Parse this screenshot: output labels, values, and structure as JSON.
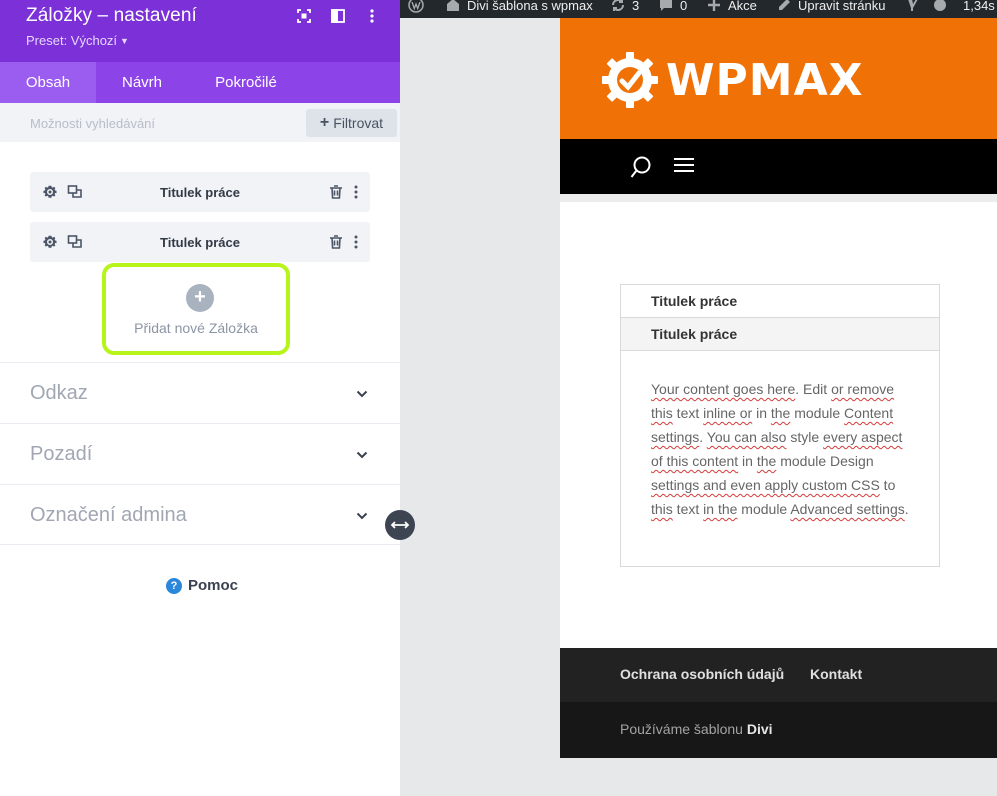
{
  "panel": {
    "title": "Záložky – nastavení",
    "preset_label": "Preset: Výchozí",
    "tabs": [
      {
        "label": "Obsah",
        "active": true
      },
      {
        "label": "Návrh",
        "active": false
      },
      {
        "label": "Pokročilé",
        "active": false
      }
    ],
    "search_placeholder": "Možnosti vyhledávání",
    "filter_label": "Filtrovat",
    "items": [
      {
        "label": "Titulek práce"
      },
      {
        "label": "Titulek práce"
      }
    ],
    "add_label": "Přidat nové Záložka",
    "sections": [
      {
        "label": "Odkaz"
      },
      {
        "label": "Pozadí"
      },
      {
        "label": "Označení admina"
      }
    ],
    "help_label": "Pomoc",
    "accent_color": "#7b30d8",
    "highlight_color": "#b7f51a"
  },
  "adminbar": {
    "site_name": "Divi šablona s wpmax",
    "updates_count": "3",
    "comments_count": "0",
    "new_label": "Akce",
    "edit_label": "Upravit stránku",
    "load_time": "1,34s"
  },
  "site": {
    "logo_text": "WPMAX",
    "brand_color": "#f07207",
    "tabs": [
      {
        "title": "Titulek práce"
      },
      {
        "title": "Titulek práce"
      }
    ],
    "content_parts": [
      {
        "t": "Your content goes here",
        "sq": true
      },
      {
        "t": ". Edit ",
        "sq": false
      },
      {
        "t": "or remove",
        "sq": true
      },
      {
        "t": " ",
        "sq": false
      },
      {
        "t": "this",
        "sq": true
      },
      {
        "t": " text ",
        "sq": false
      },
      {
        "t": "inline or",
        "sq": true
      },
      {
        "t": " in ",
        "sq": false
      },
      {
        "t": "the",
        "sq": true
      },
      {
        "t": " module ",
        "sq": false
      },
      {
        "t": "Content settings",
        "sq": true
      },
      {
        "t": ". ",
        "sq": false
      },
      {
        "t": "You can also",
        "sq": true
      },
      {
        "t": " style ",
        "sq": false
      },
      {
        "t": "every aspect of this content",
        "sq": true
      },
      {
        "t": " in ",
        "sq": false
      },
      {
        "t": "the",
        "sq": true
      },
      {
        "t": " module Design ",
        "sq": false
      },
      {
        "t": "settings and even apply custom CSS",
        "sq": true
      },
      {
        "t": " to ",
        "sq": false
      },
      {
        "t": "this",
        "sq": true
      },
      {
        "t": " text ",
        "sq": false
      },
      {
        "t": "in the",
        "sq": true
      },
      {
        "t": " module ",
        "sq": false
      },
      {
        "t": "Advanced settings",
        "sq": true
      },
      {
        "t": ".",
        "sq": false
      }
    ],
    "footer_links": [
      "Ochrana osobních údajů",
      "Kontakt"
    ],
    "footer_text": "Používáme šablonu",
    "footer_brand": "Divi"
  }
}
